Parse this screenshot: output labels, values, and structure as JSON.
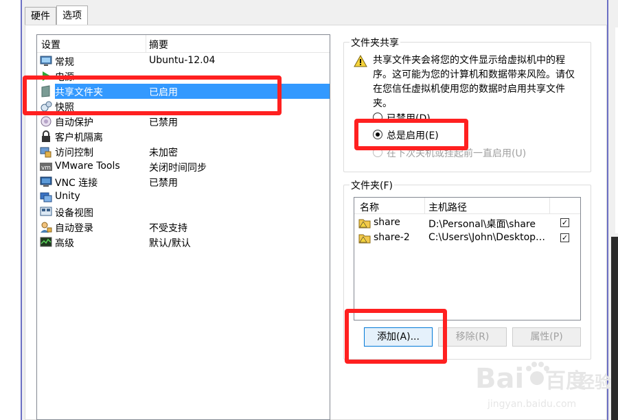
{
  "tabs": [
    {
      "label": "硬件"
    },
    {
      "label": "选项"
    }
  ],
  "settings_list": {
    "headers": {
      "name": "设置",
      "summary": "摘要"
    },
    "rows": [
      {
        "label": "常规",
        "summary": "Ubuntu-12.04",
        "icon": "monitor-icon"
      },
      {
        "label": "电源",
        "summary": "",
        "icon": "power-play-icon"
      },
      {
        "label": "共享文件夹",
        "summary": "已启用",
        "icon": "shared-folder-icon"
      },
      {
        "label": "快照",
        "summary": "",
        "icon": "snapshot-icon"
      },
      {
        "label": "自动保护",
        "summary": "已禁用",
        "icon": "autoprotect-icon"
      },
      {
        "label": "客户机隔离",
        "summary": "",
        "icon": "lock-icon"
      },
      {
        "label": "访问控制",
        "summary": "未加密",
        "icon": "access-control-icon"
      },
      {
        "label": "VMware Tools",
        "summary": "关闭时间同步",
        "icon": "vm-icon"
      },
      {
        "label": "VNC 连接",
        "summary": "已禁用",
        "icon": "vnc-icon"
      },
      {
        "label": "Unity",
        "summary": "",
        "icon": "unity-icon"
      },
      {
        "label": "设备视图",
        "summary": "",
        "icon": "device-view-icon"
      },
      {
        "label": "自动登录",
        "summary": "不受支持",
        "icon": "auto-login-icon"
      },
      {
        "label": "高级",
        "summary": "默认/默认",
        "icon": "advanced-icon"
      }
    ]
  },
  "folder_sharing": {
    "title": "文件夹共享",
    "warning": "共享文件夹会将您的文件显示给虚拟机中的程序。这可能为您的计算机和数据带来风险。请仅在您信任虚拟机使用您的数据时启用共享文件夹。",
    "options": [
      {
        "label": "已禁用(D)",
        "selected": false,
        "disabled": false
      },
      {
        "label": "总是启用(E)",
        "selected": true,
        "disabled": false
      },
      {
        "label": "在下次关机或挂起前一直启用(U)",
        "selected": false,
        "disabled": true
      }
    ]
  },
  "folders": {
    "title": "文件夹(F)",
    "headers": {
      "name": "名称",
      "path": "主机路径"
    },
    "rows": [
      {
        "name": "share",
        "path": "D:\\Personal\\桌面\\share",
        "checked": true
      },
      {
        "name": "share-2",
        "path": "C:\\Users\\John\\Desktop…",
        "checked": true
      }
    ],
    "buttons": {
      "add": "添加(A)...",
      "remove": "移除(R)",
      "properties": "属性(P)"
    }
  },
  "watermark": {
    "brand": "Bai",
    "brand2": "百度",
    "site": "jingyan.baidu.com",
    "label": "经验"
  },
  "colors": {
    "selection": "#3399ff",
    "highlight": "#ff2020",
    "border_accent": "#6a6ec4"
  }
}
